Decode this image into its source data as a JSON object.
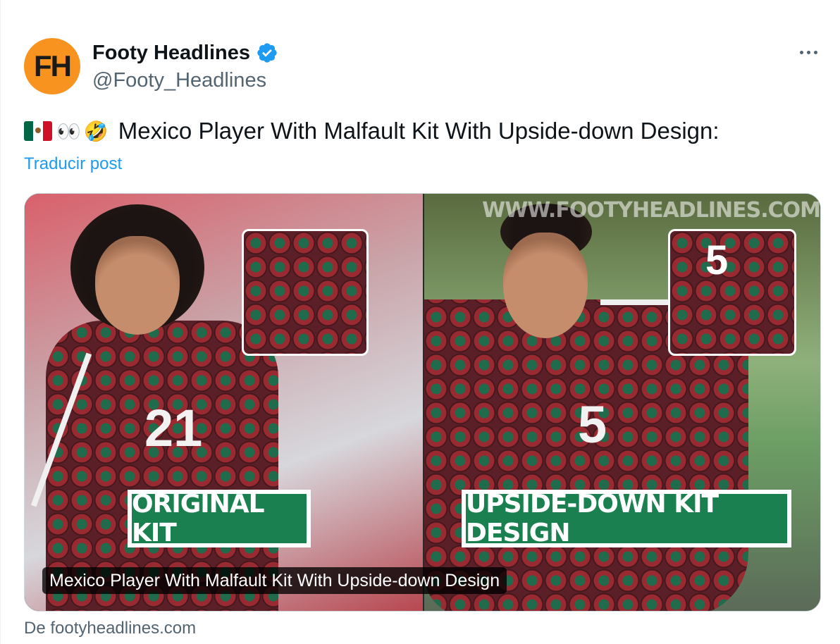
{
  "author": {
    "avatar_initials": "FH",
    "display_name": "Footy Headlines",
    "handle": "@Footy_Headlines",
    "verified": true
  },
  "post": {
    "emojis": [
      "mexico-flag",
      "eyes",
      "rolling-on-floor-laughing"
    ],
    "eyes_emoji": "👀",
    "laugh_emoji": "🤣",
    "text": "Mexico Player With Malfault Kit With Upside-down Design:",
    "translate_label": "Traducir post"
  },
  "media": {
    "watermark": "WWW.FOOTYHEADLINES.COM",
    "left_panel": {
      "jersey_number": "21",
      "banner": "ORIGINAL KIT"
    },
    "right_panel": {
      "jersey_number": "5",
      "inset_number": "5",
      "banner": "UPSIDE-DOWN KIT DESIGN"
    },
    "caption": "Mexico Player With Malfault Kit With Upside-down Design"
  },
  "source_label": "De footyheadlines.com",
  "colors": {
    "accent": "#1d9bf0",
    "avatar_bg": "#f7931e",
    "banner_green": "#1a8050",
    "kit_maroon": "#5a1f27"
  }
}
